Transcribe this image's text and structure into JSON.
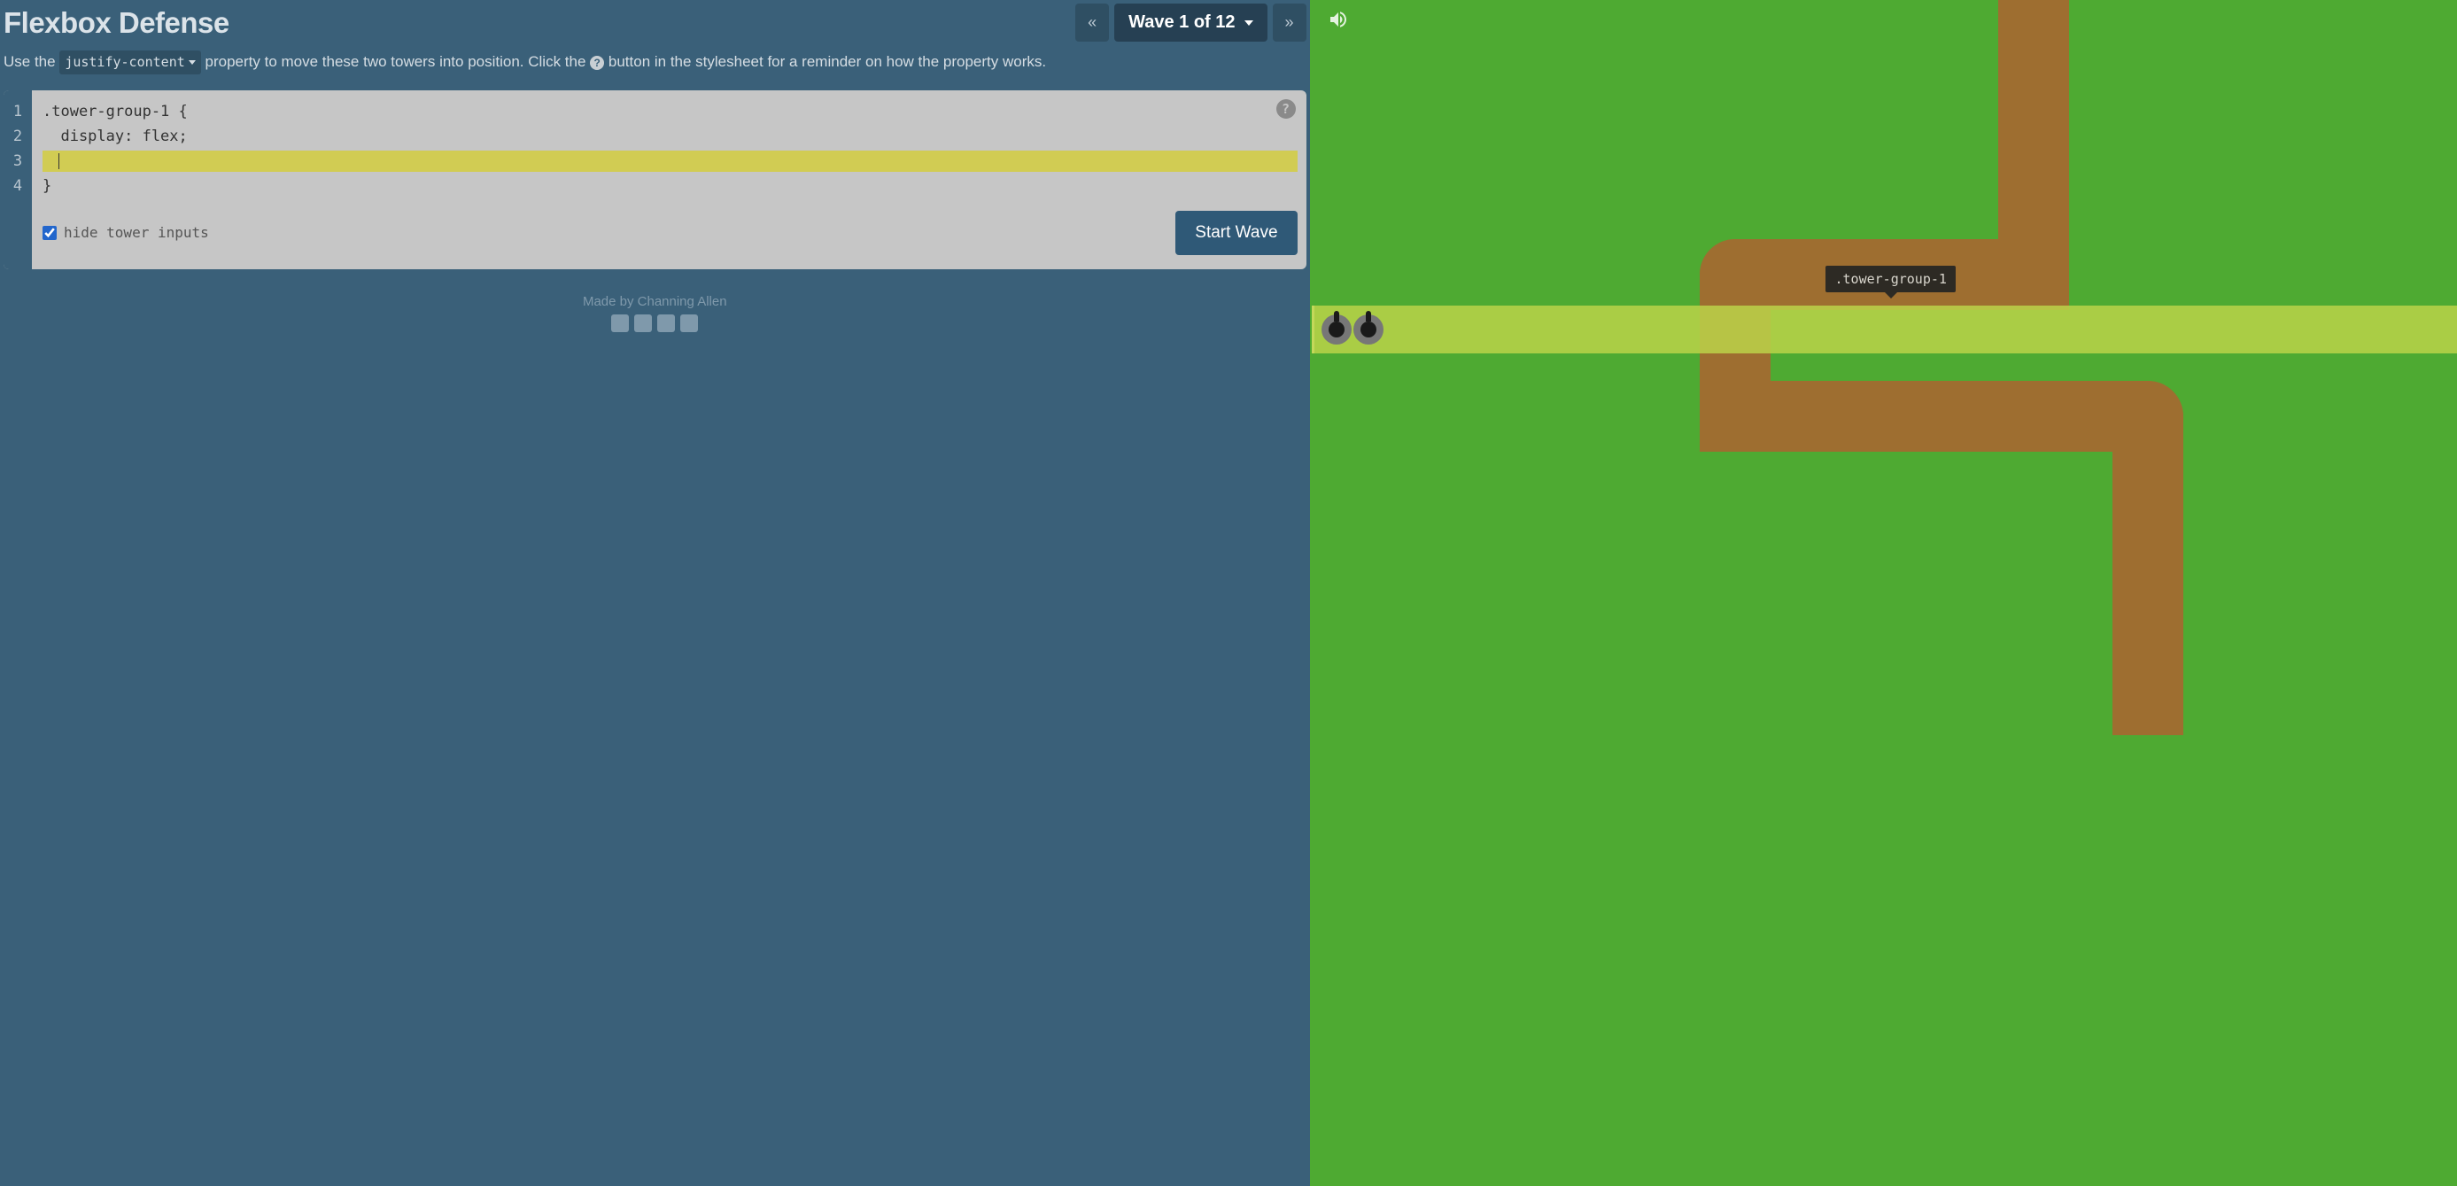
{
  "header": {
    "title": "Flexbox Defense",
    "prev_label": "«",
    "wave_label": "Wave 1 of 12",
    "next_label": "»"
  },
  "instructions": {
    "pre": "Use the ",
    "property": "justify-content",
    "mid": " property to move these two towers into position. Click the ",
    "help": "?",
    "post": " button in the stylesheet for a reminder on how the property works."
  },
  "editor": {
    "lines": [
      "1",
      "2",
      "3",
      "4"
    ],
    "line1": ".tower-group-1 {",
    "line2": "  display: flex;",
    "line4": "}",
    "input_value": "",
    "help_symbol": "?"
  },
  "footer": {
    "hide_label": "hide tower inputs",
    "hide_checked": true,
    "start_label": "Start Wave"
  },
  "credits": {
    "text": "Made by Channing Allen"
  },
  "game": {
    "tooltip": ".tower-group-1"
  }
}
